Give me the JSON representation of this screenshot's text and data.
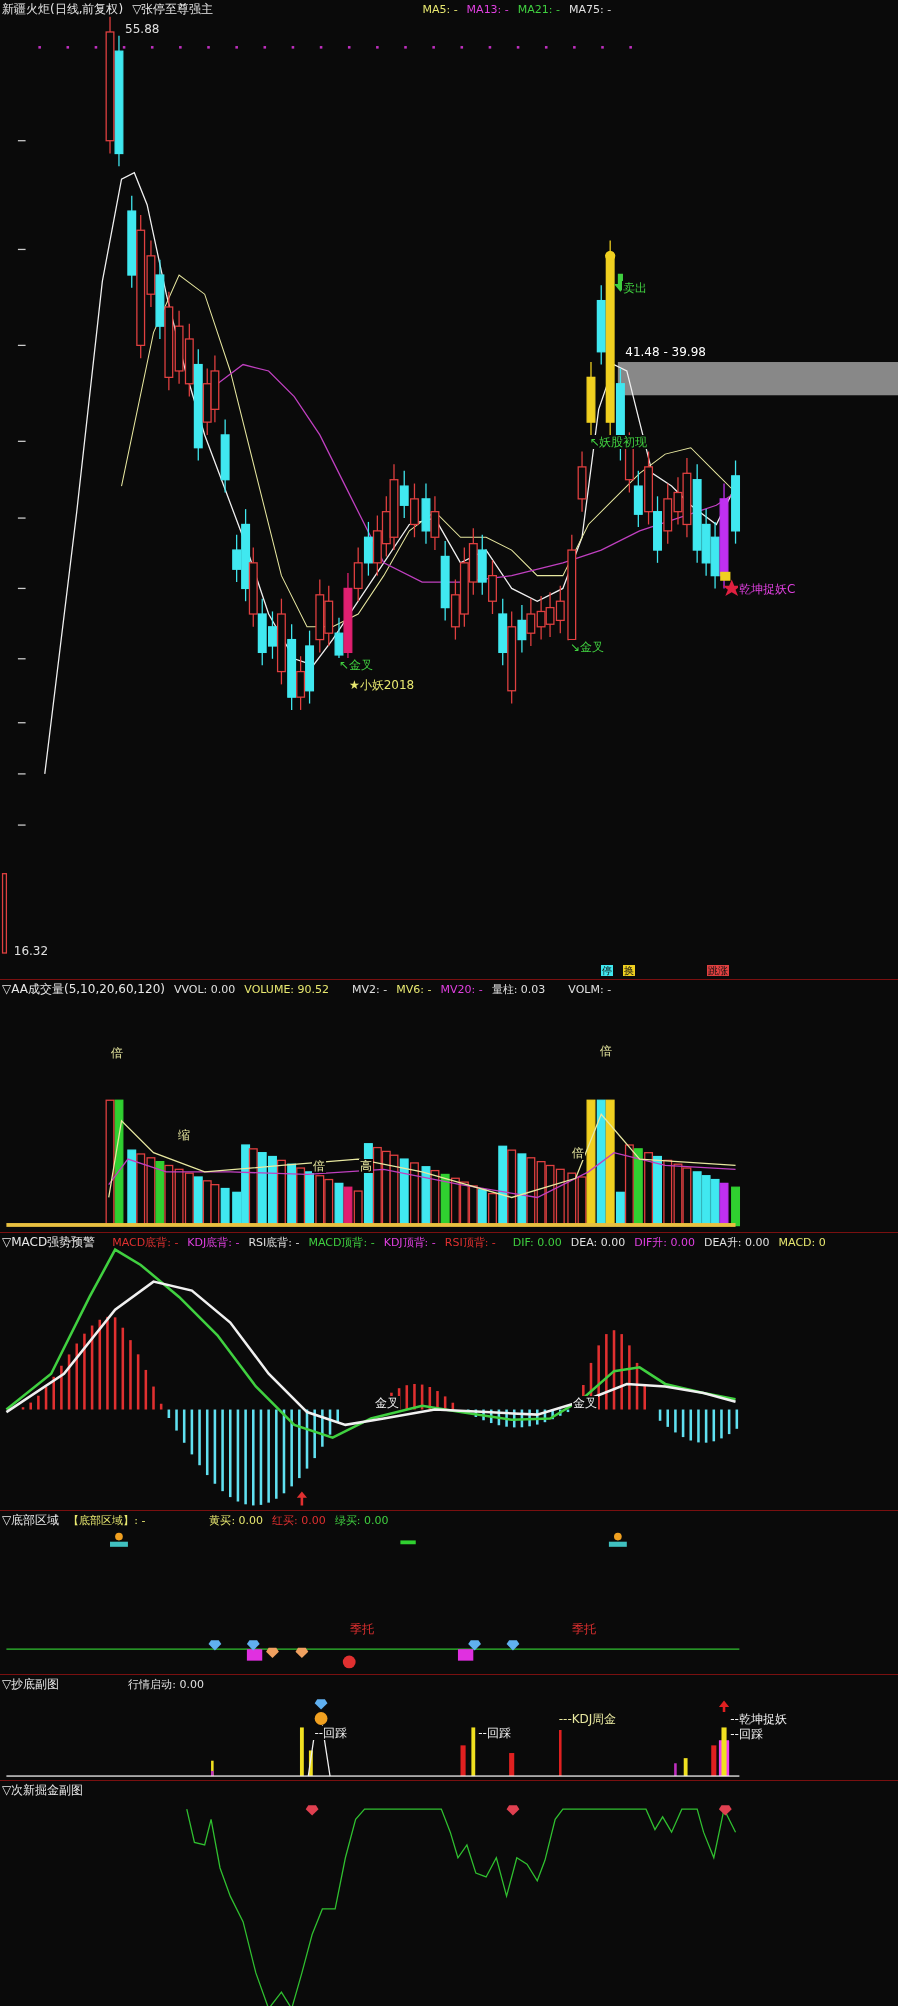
{
  "main": {
    "title": "新疆火炬(日线,前复权)",
    "indicator": "▽张停至尊强主",
    "legend": [
      "MA5: -",
      "MA13: -",
      "MA21: -",
      "MA75: -"
    ],
    "price_labels": [
      "55.88",
      "16.32"
    ],
    "zone_label": "41.48 - 39.98",
    "annotations": [
      {
        "kind": "sell",
        "text": "卖出"
      },
      {
        "kind": "signal",
        "text": "↖妖股初现"
      },
      {
        "kind": "catch",
        "text": "乾坤捉妖C"
      },
      {
        "kind": "cross",
        "text": "↖金叉"
      },
      {
        "kind": "cross",
        "text": "↘金叉"
      },
      {
        "kind": "star",
        "text": "★小妖2018"
      }
    ],
    "markers": [
      "停",
      "换",
      "跳涨"
    ]
  },
  "volume": {
    "title": "▽AA成交量(5,10,20,60,120)",
    "legend": [
      "VVOL: 0.00",
      "VOLUME: 90.52",
      "MV2: -",
      "MV6: -",
      "MV20: -",
      "量柱: 0.03",
      "VOLM: -"
    ],
    "annotations": [
      "倍",
      "倍",
      "缩",
      "倍",
      "高",
      "倍"
    ]
  },
  "macd": {
    "title": "▽MACD强势预警",
    "legend": [
      "MACD底背: -",
      "KDJ底背: -",
      "RSI底背: -",
      "MACD顶背: -",
      "KDJ顶背: -",
      "RSI顶背: -",
      "DIF: 0.00",
      "DEA: 0.00",
      "DIF升: 0.00",
      "DEA升: 0.00",
      "MACD: 0"
    ],
    "annotations": [
      "金叉",
      "金叉"
    ]
  },
  "bottom": {
    "title": "▽底部区域",
    "legend": [
      "【底部区域】: -",
      "黄买: 0.00",
      "红买: 0.00",
      "绿买: 0.00"
    ],
    "annotations": [
      "季托",
      "季托"
    ]
  },
  "chaodi": {
    "title": "▽抄底副图",
    "legend": [
      "行情启动: 0.00"
    ],
    "annotations": [
      {
        "kind": "label",
        "text": "--回踩"
      },
      {
        "kind": "label",
        "text": "--回踩"
      },
      {
        "kind": "kdj",
        "text": "---KDJ周金"
      },
      {
        "kind": "label",
        "text": "--乾坤捉妖"
      },
      {
        "kind": "label",
        "text": "--回踩"
      }
    ]
  },
  "cixin": {
    "title": "▽次新掘金副图"
  }
}
